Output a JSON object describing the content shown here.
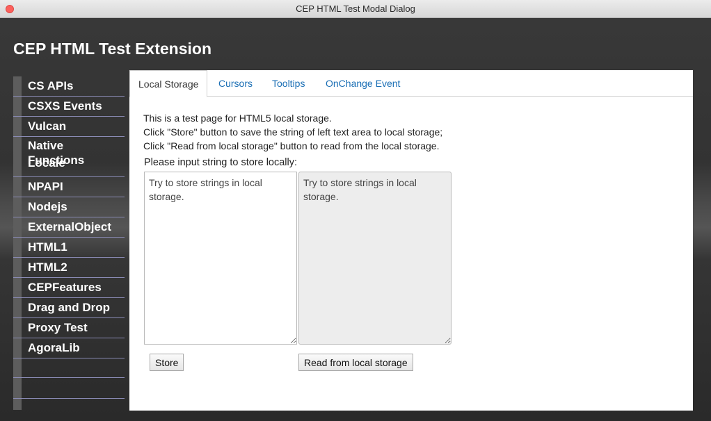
{
  "window": {
    "title": "CEP HTML Test Modal Dialog"
  },
  "extension_title": "CEP HTML Test Extension",
  "sidebar": {
    "items": [
      {
        "label": "CS APIs"
      },
      {
        "label": "CSXS Events"
      },
      {
        "label": "Vulcan"
      },
      {
        "label": "Native Functions"
      },
      {
        "label": "Locale"
      },
      {
        "label": "NPAPI"
      },
      {
        "label": "Nodejs"
      },
      {
        "label": "ExternalObject"
      },
      {
        "label": "HTML1"
      },
      {
        "label": "HTML2"
      },
      {
        "label": "CEPFeatures"
      },
      {
        "label": "Drag and Drop"
      },
      {
        "label": "Proxy Test"
      },
      {
        "label": "AgoraLib"
      },
      {
        "label": ""
      }
    ]
  },
  "tabs": [
    {
      "label": "Local Storage",
      "active": true
    },
    {
      "label": "Cursors"
    },
    {
      "label": "Tooltips"
    },
    {
      "label": "OnChange Event"
    }
  ],
  "local_storage": {
    "description_lines": [
      "This is a test page for HTML5 local storage.",
      "Click \"Store\" button to save the string of left text area to local storage;",
      "Click \"Read from local storage\" button to read from the local storage."
    ],
    "input_label": "Please input string to store locally:",
    "input_value": "Try to store strings in local storage.",
    "output_value": "Try to store strings in local storage.",
    "store_button": "Store",
    "read_button": "Read from local storage"
  },
  "colors": {
    "tab_link": "#1b6fb5",
    "sidebar_divider": "#8a8bb5",
    "close_button": "#fc605c"
  }
}
